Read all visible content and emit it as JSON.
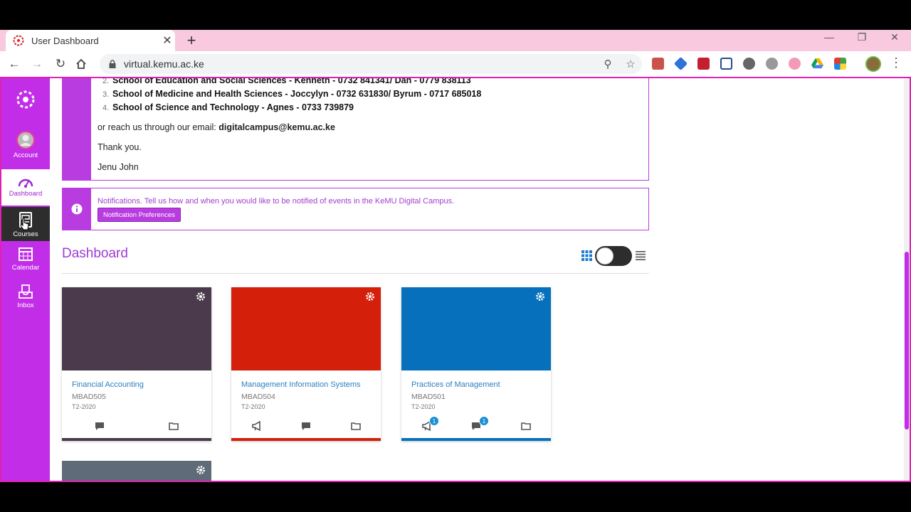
{
  "browser": {
    "tab_title": "User Dashboard",
    "url": "virtual.kemu.ac.ke"
  },
  "sidenav": {
    "account": "Account",
    "dashboard": "Dashboard",
    "courses": "Courses",
    "calendar": "Calendar",
    "inbox": "Inbox"
  },
  "announcement": {
    "school2_num": "2.",
    "school2": "School of Education and Social Sciences - Kenneth - 0732 841341/ Dan - 0779 838113",
    "school3_num": "3.",
    "school3": "School of Medicine and Health Sciences - Joccylyn - 0732 631830/ Byrum - 0717 685018",
    "school4_num": "4.",
    "school4": "School of Science and Technology - Agnes - 0733 739879",
    "email_prefix": "or reach us through our email:",
    "email": "digitalcampus@kemu.ac.ke",
    "thanks": "Thank you.",
    "signature": "Jenu John"
  },
  "notification": {
    "text": "Notifications.  Tell us how and when you would like to be notified of events in the KeMU Digital Campus.",
    "button": "Notification Preferences"
  },
  "dashboard": {
    "title": "Dashboard"
  },
  "cards": [
    {
      "name": "Financial Accounting",
      "code": "MBAD505",
      "term": "T2-2020",
      "color": "#4a3a4b"
    },
    {
      "name": "Management Information Systems",
      "code": "MBAD504",
      "term": "T2-2020",
      "color": "#d41f0a"
    },
    {
      "name": "Practices of Management",
      "code": "MBAD501",
      "term": "T2-2020",
      "color": "#0770bd",
      "announcements_badge": "1",
      "discussions_badge": "1"
    },
    {
      "color": "#5f6b78"
    }
  ],
  "colors": {
    "brand": "#c22ee8",
    "link": "#2d7fbf",
    "border": "#e020b0"
  }
}
